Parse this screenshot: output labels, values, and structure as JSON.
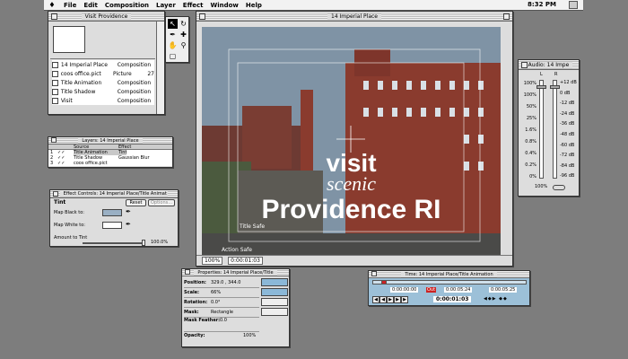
{
  "menu": {
    "items": [
      "File",
      "Edit",
      "Composition",
      "Layer",
      "Effect",
      "Window",
      "Help"
    ],
    "clock": "8:32 PM"
  },
  "project": {
    "title": "Visit Providence",
    "items": [
      {
        "name": "14 Imperial Place",
        "type": "Composition",
        "size": ""
      },
      {
        "name": "coos office.pict",
        "type": "Picture",
        "size": "27"
      },
      {
        "name": "Title Animation",
        "type": "Composition",
        "size": ""
      },
      {
        "name": "Title Shadow",
        "type": "Composition",
        "size": ""
      },
      {
        "name": "Visit",
        "type": "Composition",
        "size": ""
      }
    ]
  },
  "comp": {
    "title": "14 Imperial Place",
    "line1": "visit",
    "line2": "scenic",
    "line3": "Providence RI",
    "title_safe": "Title Safe",
    "action_safe": "Action Safe",
    "zoom": "100%",
    "time": "0:00:01:03",
    "colors": {
      "sky": "#7f93a5",
      "brick": "#8a3b2e",
      "text": "#ffffff"
    }
  },
  "layers": {
    "title": "Layers: 14 Imperial Place",
    "col_source": "Source",
    "col_effect": "Effect",
    "rows": [
      {
        "num": "1",
        "name": "Title Animation",
        "effect": "Tint",
        "selected": true
      },
      {
        "num": "2",
        "name": "Title Shadow",
        "effect": "Gaussian Blur",
        "selected": false
      },
      {
        "num": "3",
        "name": "coos office.pict",
        "effect": "",
        "selected": false
      }
    ]
  },
  "effect": {
    "title": "Effect Controls: 14 Imperial Place/Title Animat",
    "name": "Tint",
    "reset": "Reset",
    "options": "Options...",
    "map_black": "Map Black to:",
    "map_white": "Map White to:",
    "amount": "Amount to Tint",
    "amount_value": "100.0%",
    "amount_level": 1.0
  },
  "audio": {
    "title": "Audio: 14 Impe",
    "left": "L",
    "right": "R",
    "left_scale": [
      "100%",
      "100%",
      "50%",
      "25%",
      "1.6%",
      "0.8%",
      "0.4%",
      "0.2%",
      "0%"
    ],
    "right_scale": [
      "+12 dB",
      "0 dB",
      "-12 dB",
      "-24 dB",
      "-36 dB",
      "-48 dB",
      "-60 dB",
      "-72 dB",
      "-84 dB",
      "-96 dB"
    ],
    "bottom_value": "100%"
  },
  "properties": {
    "title": "Properties: 14 Imperial Place/Title",
    "rows": [
      {
        "label": "Position:",
        "value": "329.0 , 344.0"
      },
      {
        "label": "Scale:",
        "value": "66%"
      },
      {
        "label": "Rotation:",
        "value": "0.0°"
      },
      {
        "label": "Mask:",
        "value": "Rectangle"
      },
      {
        "label": "Mask Feather:",
        "value": "0.0"
      },
      {
        "label": "Opacity:",
        "value": "100%"
      }
    ]
  },
  "time": {
    "title": "Time: 14 Imperial Place/Title Animation",
    "start": "0:00:00:00",
    "out_label": "Out",
    "out": "0:00:05:24",
    "duration": "0:00:05:25",
    "current": "0:00:01:03"
  }
}
